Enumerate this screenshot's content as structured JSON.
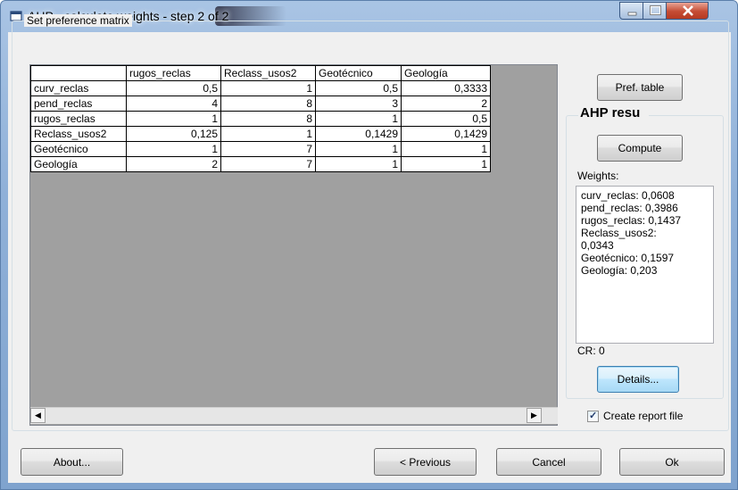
{
  "window": {
    "title": "AHP - calculate weights - step 2 of 2"
  },
  "group": {
    "label": "Set preference matrix"
  },
  "matrix": {
    "columns": [
      "rugos_reclas",
      "Reclass_usos2",
      "Geotécnico",
      "Geología"
    ],
    "rows": [
      {
        "label": "curv_reclas",
        "values": [
          "0,5",
          "1",
          "0,5",
          "0,3333"
        ]
      },
      {
        "label": "pend_reclas",
        "values": [
          "4",
          "8",
          "3",
          "2"
        ]
      },
      {
        "label": "rugos_reclas",
        "values": [
          "1",
          "8",
          "1",
          "0,5"
        ]
      },
      {
        "label": "Reclass_usos2",
        "values": [
          "0,125",
          "1",
          "0,1429",
          "0,1429"
        ]
      },
      {
        "label": "Geotécnico",
        "values": [
          "1",
          "7",
          "1",
          "1"
        ]
      },
      {
        "label": "Geología",
        "values": [
          "2",
          "7",
          "1",
          "1"
        ]
      }
    ]
  },
  "right_panel": {
    "pref_table_label": "Pref. table",
    "ahp_result_label": "AHP resu",
    "compute_label": "Compute",
    "weights_label": "Weights:",
    "weights_lines": [
      "curv_reclas: 0,0608",
      "pend_reclas: 0,3986",
      "rugos_reclas: 0,1437",
      "Reclass_usos2:",
      "0,0343",
      "Geotécnico: 0,1597",
      "Geología: 0,203"
    ],
    "cr_label": "CR: 0",
    "details_label": "Details...",
    "report_checkbox_label": "Create report file",
    "report_checked": true
  },
  "footer": {
    "about_label": "About...",
    "previous_label": "< Previous",
    "cancel_label": "Cancel",
    "ok_label": "Ok"
  },
  "icons": {
    "app": "app-window-icon",
    "scroll_left": "scroll-left-arrow-icon",
    "scroll_right": "scroll-right-arrow-icon"
  }
}
